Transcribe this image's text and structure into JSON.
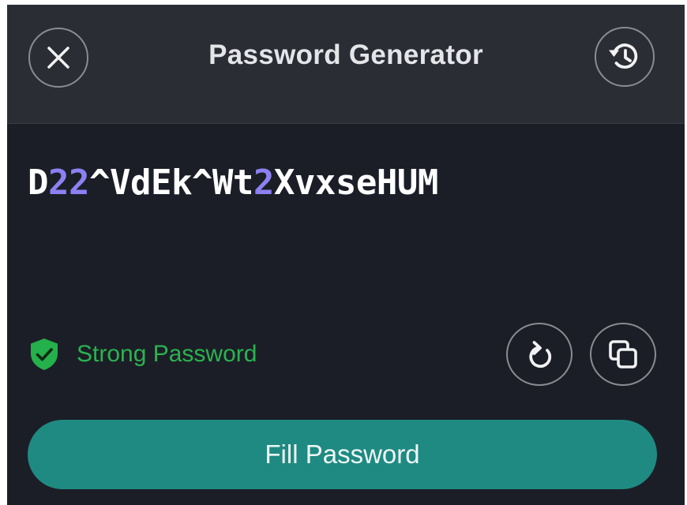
{
  "header": {
    "title": "Password Generator",
    "close_icon": "close-icon",
    "history_icon": "history-icon"
  },
  "password": {
    "segments": [
      {
        "text": "D",
        "type": "letter"
      },
      {
        "text": "22",
        "type": "digit"
      },
      {
        "text": "^VdEk^Wt",
        "type": "letter"
      },
      {
        "text": "2",
        "type": "digit"
      },
      {
        "text": "XvxseHUM",
        "type": "letter"
      }
    ]
  },
  "strength": {
    "label": "Strong Password",
    "icon": "shield-check-icon"
  },
  "actions": {
    "regenerate_icon": "refresh-icon",
    "copy_icon": "copy-icon",
    "fill_label": "Fill Password"
  },
  "colors": {
    "background": "#1b1e27",
    "header": "#2a2d34",
    "digit": "#8d80f2",
    "strong": "#2bb34f",
    "fill_button": "#1f8a82"
  }
}
